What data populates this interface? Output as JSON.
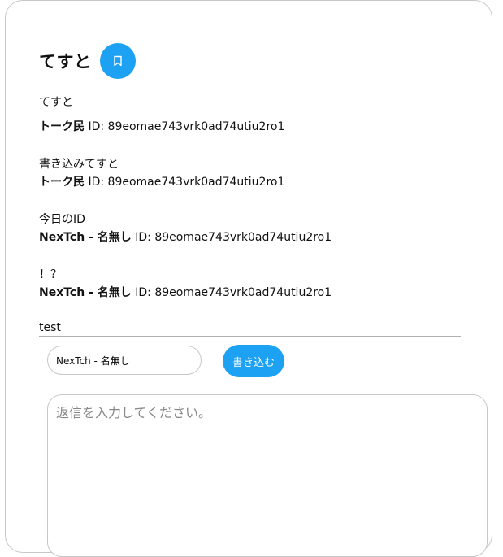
{
  "thread": {
    "title": "てすと",
    "bookmark_icon": "bookmark-icon",
    "description": "てすと"
  },
  "posts": [
    {
      "body": "",
      "author": "トーク民",
      "id_label": "ID:",
      "id": "89eomae743vrk0ad74utiu2ro1"
    },
    {
      "body": "書き込みてすと",
      "author": "トーク民",
      "id_label": "ID:",
      "id": "89eomae743vrk0ad74utiu2ro1"
    },
    {
      "body": "今日のID",
      "author": "NexTch - 名無し",
      "id_label": "ID:",
      "id": "89eomae743vrk0ad74utiu2ro1"
    },
    {
      "body": "！？",
      "author": "NexTch - 名無し",
      "id_label": "ID:",
      "id": "89eomae743vrk0ad74utiu2ro1"
    },
    {
      "body": "test"
    }
  ],
  "form": {
    "name_value": "NexTch - 名無し",
    "submit_label": "書き込む",
    "reply_placeholder": "返信を入力してください。"
  },
  "colors": {
    "accent": "#1da1f2",
    "border": "#c8c8c8"
  }
}
